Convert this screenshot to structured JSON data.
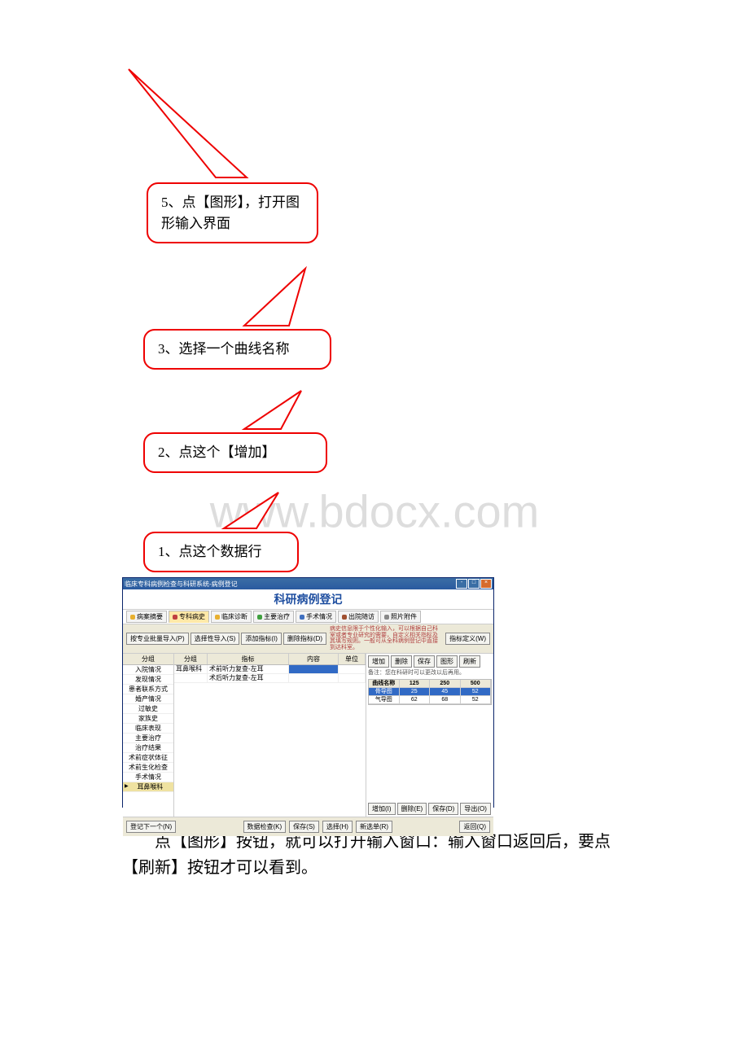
{
  "watermark": "www.bdocx.com",
  "callouts": {
    "c5": "5、点【图形】，打开图形输入界面",
    "c3": "3、选择一个曲线名称",
    "c2": "2、点这个【增加】",
    "c1": "1、点这个数据行"
  },
  "shot": {
    "window_title": "临床专科病例检查与科研系统-病例登记",
    "page_title": "科研病例登记",
    "tabs": [
      "病案摘要",
      "专科病史",
      "临床诊断",
      "主要治疗",
      "手术情况",
      "出院随访",
      "照片附件"
    ],
    "import_btns": [
      "按专业批量导入(P)",
      "选择性导入(S)",
      "添加指标(I)",
      "删除指标(D)"
    ],
    "def_btn": "指标定义(W)",
    "tip": "病史信息限于个性化输入，可以根据自己科室或者专业研究的需要，自定义相关指标及其填写规则。一般可从全科病例登记中直接到达科室。",
    "side_header": "分组",
    "side_items": [
      "入院情况",
      "发现情况",
      "患者联系方式",
      "婚产情况",
      "过敏史",
      "家族史",
      "临床表现",
      "主要治疗",
      "治疗结果",
      "术前症状体征",
      "术前生化检查",
      "手术情况",
      "耳鼻喉科"
    ],
    "ct_headers": [
      "分组",
      "指标",
      "内容",
      "单位"
    ],
    "ct_rows": [
      {
        "a": "耳鼻喉科",
        "b": "术前听力复查-左耳",
        "c": "",
        "d": "",
        "sel": true
      },
      {
        "a": "",
        "b": "术后听力复查-左耳",
        "c": "",
        "d": ""
      }
    ],
    "rp_buttons": [
      "增加",
      "删除",
      "保存",
      "图形",
      "刷新"
    ],
    "rp_note": "备注：您在科研时可以更改以后再用。",
    "rp_headers": [
      "曲线名称",
      "125",
      "250",
      "500"
    ],
    "rp_rows": [
      {
        "name": "骨导图",
        "v1": "25",
        "v2": "45",
        "v3": "52",
        "sel": true
      },
      {
        "name": "气导图",
        "v1": "62",
        "v2": "68",
        "v3": "52"
      }
    ],
    "rp_bottom": [
      "增加(I)",
      "删除(E)",
      "保存(D)",
      "导出(O)"
    ],
    "footer": [
      "登记下一个(N)",
      "数据检查(K)",
      "保存(S)",
      "选择(H)",
      "新选单(R)",
      "返回(Q)"
    ]
  },
  "paragraph": "点【图形】按钮，就可以打开输入窗口：输入窗口返回后，要点【刷新】按钮才可以看到。"
}
